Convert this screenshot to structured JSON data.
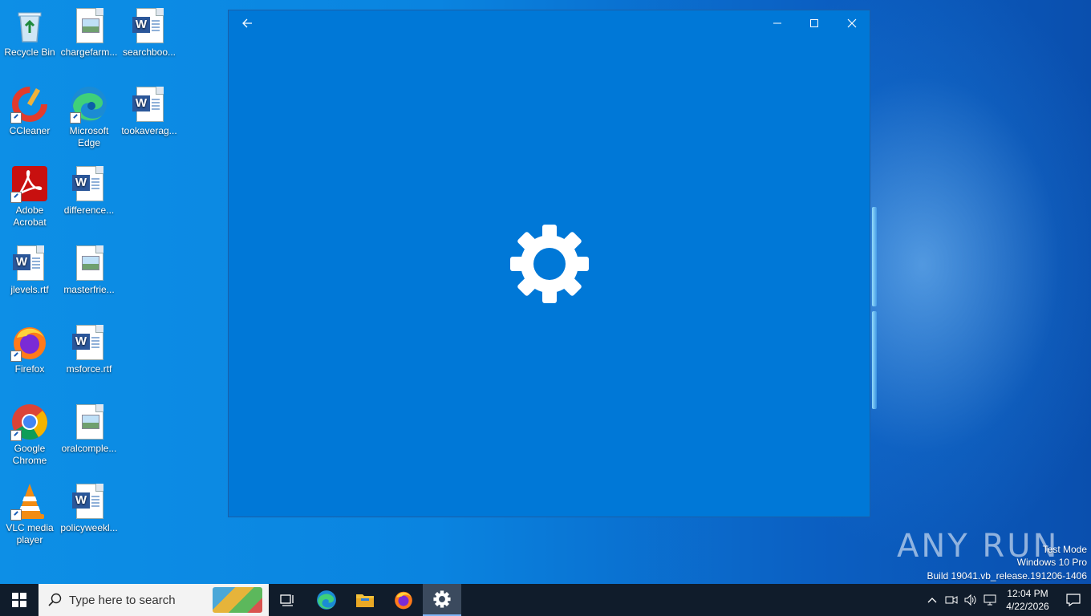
{
  "desktop": {
    "icons": [
      {
        "label": "Recycle Bin",
        "icon": "recycle-bin-icon"
      },
      {
        "label": "chargefarm...",
        "icon": "image-file-icon"
      },
      {
        "label": "searchboo...",
        "icon": "word-document-icon"
      },
      {
        "label": "CCleaner",
        "icon": "ccleaner-icon"
      },
      {
        "label": "Microsoft Edge",
        "icon": "edge-icon"
      },
      {
        "label": "tookaverag...",
        "icon": "word-document-icon"
      },
      {
        "label": "Adobe Acrobat",
        "icon": "acrobat-icon"
      },
      {
        "label": "difference...",
        "icon": "word-document-icon"
      },
      {
        "label": "jlevels.rtf",
        "icon": "word-document-icon"
      },
      {
        "label": "masterfrie...",
        "icon": "image-file-icon"
      },
      {
        "label": "Firefox",
        "icon": "firefox-icon"
      },
      {
        "label": "msforce.rtf",
        "icon": "word-document-icon"
      },
      {
        "label": "Google Chrome",
        "icon": "chrome-icon"
      },
      {
        "label": "oralcomple...",
        "icon": "image-file-icon"
      },
      {
        "label": "VLC media player",
        "icon": "vlc-icon"
      },
      {
        "label": "policyweekl...",
        "icon": "word-document-icon"
      }
    ]
  },
  "settings_window": {
    "back_icon": "back-arrow-icon",
    "minimize_glyph": "—",
    "maximize_glyph": "□",
    "close_glyph": "✕",
    "splash_icon": "gear-icon",
    "background": "#0078d7"
  },
  "watermark": {
    "brand": "ANY RUN",
    "line1": "Test Mode",
    "line2": "Windows 10 Pro",
    "line3": "Build 19041.vb_release.191206-1406"
  },
  "taskbar": {
    "search_placeholder": "Type here to search",
    "apps": [
      "task-view-icon",
      "edge-icon",
      "file-explorer-icon",
      "firefox-icon",
      "settings-icon"
    ],
    "clock_time": "12:04 PM",
    "clock_date": "4/22/2026"
  }
}
